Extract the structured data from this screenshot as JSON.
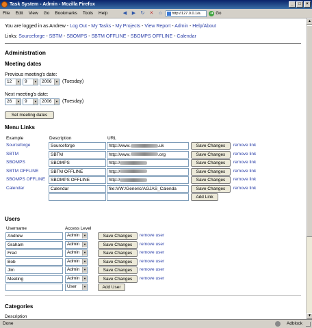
{
  "window": {
    "title": "Task System - Admin - Mozilla Firefox"
  },
  "menu": [
    "File",
    "Edit",
    "View",
    "Go",
    "Bookmarks",
    "Tools",
    "Help"
  ],
  "address": {
    "url": "http://127.0.0.1/a",
    "go": "Go"
  },
  "header": {
    "logged_in_as": "You are logged in as Andrew -",
    "nav": [
      "Log Out",
      "My Tasks",
      "My Projects",
      "View Report",
      "Admin",
      "Help/About"
    ],
    "links_label": "Links:",
    "links": [
      "Sourceforge",
      "SBTM",
      "SBOMPS",
      "SBTM OFFLINE",
      "SBOMPS OFFLINE",
      "Calendar"
    ]
  },
  "admin": {
    "title": "Administration"
  },
  "meeting": {
    "title": "Meeting dates",
    "previous_label": "Previous meeting's date:",
    "previous": {
      "month": "12",
      "day": "9",
      "year": "2006",
      "weekday": "(Tuesday)"
    },
    "next_label": "Next meeting's date:",
    "next": {
      "month": "26",
      "day": "9",
      "year": "2006",
      "weekday": "(Tuesday)"
    },
    "button": "Set meeting dates"
  },
  "menulinks": {
    "title": "Menu Links",
    "columns": [
      "Example",
      "Description",
      "URL"
    ],
    "rows": [
      {
        "example": "Sourceforge",
        "description": "Sourceforge",
        "url_prefix": "http://www.",
        "url_suffix": ".uk"
      },
      {
        "example": "SBTM",
        "description": "SBTM",
        "url_prefix": "http://www.",
        "url_suffix": ".org"
      },
      {
        "example": "SBOMPS",
        "description": "SBOMPS",
        "url_prefix": "http://",
        "url_suffix": ""
      },
      {
        "example": "SBTM OFFLINE",
        "description": "SBTM OFFLINE",
        "url_prefix": "http://",
        "url_suffix": ""
      },
      {
        "example": "SBOMPS OFFLINE",
        "description": "SBOMPS OFFLINE",
        "url_prefix": "http://",
        "url_suffix": ""
      },
      {
        "example": "Calendar",
        "description": "Calendar",
        "url_prefix": "file:///W:/Generic/AGJAS_Calenda",
        "url_suffix": ""
      }
    ],
    "save": "Save Changes",
    "remove": "remove link",
    "add": "Add Link"
  },
  "users": {
    "title": "Users",
    "columns": [
      "Username",
      "Access Level"
    ],
    "rows": [
      {
        "name": "Andrew",
        "level": "Admin"
      },
      {
        "name": "Graham",
        "level": "Admin"
      },
      {
        "name": "Fred",
        "level": "Admin"
      },
      {
        "name": "Bob",
        "level": "Admin"
      },
      {
        "name": "Jim",
        "level": "Admin"
      },
      {
        "name": "Meeting",
        "level": "Admin"
      }
    ],
    "new_level": "User",
    "save": "Save Changes",
    "remove": "remove user",
    "add": "Add User"
  },
  "categories": {
    "title": "Categories",
    "description_label": "Description"
  },
  "status": {
    "text": "Done",
    "addon": "Adblock"
  }
}
